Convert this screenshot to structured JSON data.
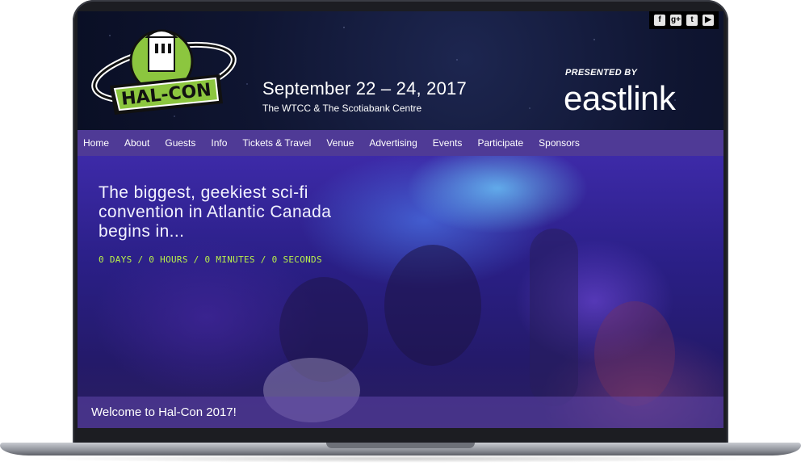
{
  "social": {
    "facebook": "f",
    "googleplus": "g+",
    "twitter": "t",
    "youtube": "▶"
  },
  "logo_text": "HAL-CON",
  "event": {
    "dates": "September 22 – 24, 2017",
    "venue": "The WTCC & The Scotiabank Centre"
  },
  "sponsor": {
    "presented_by": "PRESENTED BY",
    "name": "eastlink"
  },
  "nav": {
    "items": [
      "Home",
      "About",
      "Guests",
      "Info",
      "Tickets & Travel",
      "Venue",
      "Advertising",
      "Events",
      "Participate",
      "Sponsors"
    ]
  },
  "hero": {
    "headline": "The biggest, geekiest sci-fi convention in Atlantic Canada begins in...",
    "countdown": "0 DAYS / 0 HOURS / 0 MINUTES / 0 SECONDS",
    "welcome": "Welcome to Hal-Con 2017!"
  },
  "colors": {
    "nav_bg": "#4f3a96",
    "countdown": "#b8f04a",
    "logo_green": "#8cc63f"
  }
}
